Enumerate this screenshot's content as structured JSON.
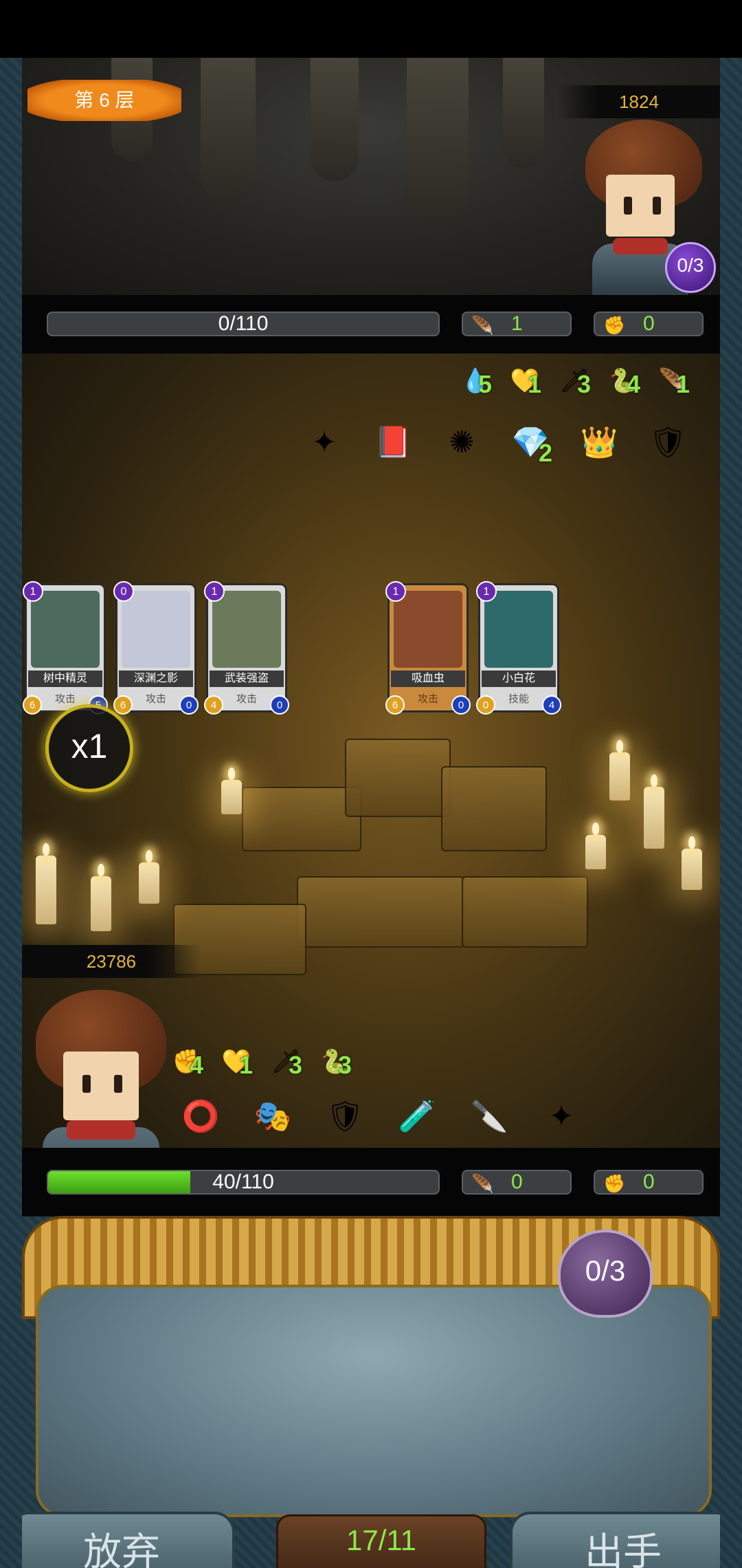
{
  "enemy": {
    "floor_label": "第 6 层",
    "score": "1824",
    "energy": "0/3",
    "hp": "0/110",
    "hp_fraction": 0,
    "shield": "1",
    "strength": "0",
    "buffs": [
      {
        "icon": "water-drop-icon",
        "glyph": "💧",
        "count": "5"
      },
      {
        "icon": "broken-heart-icon",
        "glyph": "💛",
        "count": "1"
      },
      {
        "icon": "claw-icon",
        "glyph": "🗡",
        "count": "3"
      },
      {
        "icon": "serpent-icon",
        "glyph": "🐍",
        "count": "4"
      },
      {
        "icon": "feather-icon",
        "glyph": "🪶",
        "count": "1"
      }
    ],
    "items": [
      {
        "icon": "shuriken-icon",
        "glyph": "✦"
      },
      {
        "icon": "spellbook-icon",
        "glyph": "📕"
      },
      {
        "icon": "splash-icon",
        "glyph": "✺"
      },
      {
        "icon": "blue-gem-icon",
        "glyph": "💎",
        "count": "2"
      },
      {
        "icon": "crown-icon",
        "glyph": "👑"
      },
      {
        "icon": "green-shield-icon",
        "glyph": "🛡"
      }
    ]
  },
  "board_cards": [
    {
      "name": "树中精灵",
      "type": "攻击",
      "cost": "1",
      "attack": "6",
      "defense": "5",
      "art": "#4c6a5e",
      "special": false
    },
    {
      "name": "深渊之影",
      "type": "攻击",
      "cost": "0",
      "attack": "6",
      "defense": "0",
      "art": "#c3c7d8",
      "special": false
    },
    {
      "name": "武装强盗",
      "type": "攻击",
      "cost": "1",
      "attack": "4",
      "defense": "0",
      "art": "#6b7a5a",
      "special": false
    },
    {
      "name": "吸血虫",
      "type": "攻击",
      "cost": "1",
      "attack": "6",
      "defense": "0",
      "art": "#8a4a2c",
      "special": true
    },
    {
      "name": "小白花",
      "type": "技能",
      "cost": "1",
      "attack": "0",
      "defense": "4",
      "art": "#2f6a6a",
      "special": false
    }
  ],
  "speed": "x1",
  "player": {
    "score": "23786",
    "hp": "40/110",
    "hp_fraction": 0.3636,
    "shield": "0",
    "strength": "0",
    "buffs": [
      {
        "icon": "fist-icon",
        "glyph": "✊",
        "count": "4"
      },
      {
        "icon": "broken-heart-icon",
        "glyph": "💛",
        "count": "1"
      },
      {
        "icon": "claw-icon",
        "glyph": "🗡",
        "count": "3"
      },
      {
        "icon": "serpent-icon",
        "glyph": "🐍",
        "count": "3"
      }
    ],
    "items": [
      {
        "icon": "belt-icon",
        "glyph": "⭕"
      },
      {
        "icon": "golden-mask-icon",
        "glyph": "🎭"
      },
      {
        "icon": "green-shield-icon",
        "glyph": "🛡"
      },
      {
        "icon": "potion-icon",
        "glyph": "🧪"
      },
      {
        "icon": "blade-icon",
        "glyph": "🔪"
      },
      {
        "icon": "shuriken-icon",
        "glyph": "✦"
      }
    ]
  },
  "hand": {
    "energy": "0/3",
    "deck_count": "17/11",
    "discard_label": "放弃",
    "play_label": "出手"
  },
  "colors": {
    "hp_green": "#4fc01c",
    "stack_green": "#8fe84a",
    "score_gold": "#e2b43a",
    "floor_orange": "#f08a1c"
  }
}
